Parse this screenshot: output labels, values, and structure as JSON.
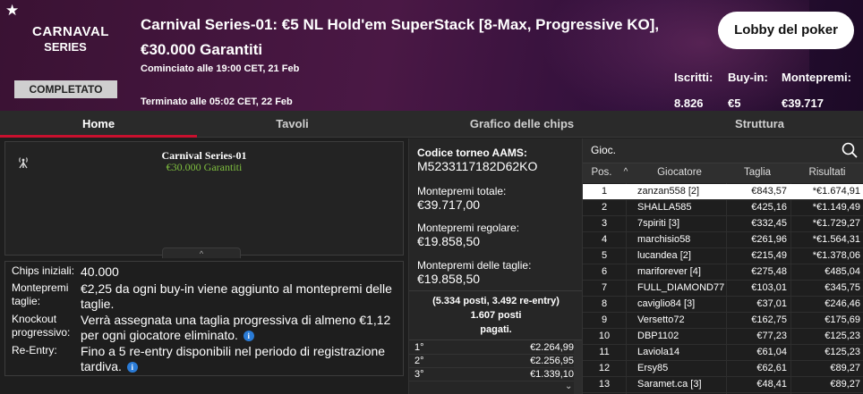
{
  "header": {
    "star": "★",
    "logo_line1": "CARNAVAL",
    "logo_line2": "SERIES",
    "status": "COMPLETATO",
    "title_line1": "Carnival Series-01: €5 NL Hold'em SuperStack [8-Max, Progressive KO],",
    "title_line2": "€30.000 Garantiti",
    "started": "Cominciato alle 19:00 CET, 21 Feb",
    "ended": "Terminato alle 05:02 CET, 22 Feb",
    "lobby_button": "Lobby del poker",
    "stats": {
      "entrants_label": "Iscritti:",
      "entrants_value": "8.826",
      "buyin_label": "Buy-in:",
      "buyin_value": "€5",
      "prizepool_label": "Montepremi:",
      "prizepool_value": "€39.717"
    }
  },
  "tabs": [
    {
      "label": "Home",
      "active": true
    },
    {
      "label": "Tavoli",
      "active": false
    },
    {
      "label": "Grafico delle chips",
      "active": false
    },
    {
      "label": "Struttura",
      "active": false
    }
  ],
  "banner": {
    "title": "Carnival Series-01",
    "subtitle": "€30.000 Garantiti",
    "collapse_glyph": "^"
  },
  "info": {
    "starting_chips_label": "Chips iniziali:",
    "starting_chips_value": "40.000",
    "bounty_pool_label": "Montepremi taglie:",
    "bounty_pool_value": "€2,25 da ogni buy-in viene aggiunto al montepremi delle taglie.",
    "knockout_label": "Knockout progressivo:",
    "knockout_value": "Verrà assegnata una taglia progressiva di almeno €1,12 per ogni giocatore eliminato.",
    "reentry_label": "Re-Entry:",
    "reentry_value": "Fino a 5 re-entry disponibili nel periodo di registrazione tardiva.",
    "info_glyph": "i"
  },
  "middle": {
    "code_label": "Codice torneo AAMS:",
    "code_value": "M5233117182D62KO",
    "total_label": "Montepremi totale:",
    "total_value": "€39.717,00",
    "regular_label": "Montepremi regolare:",
    "regular_value": "€19.858,50",
    "bounty_label": "Montepremi delle taglie:",
    "bounty_value": "€19.858,50",
    "paid_line1": "(5.334 posti, 3.492 re-entry)",
    "paid_line2": "1.607 posti",
    "paid_line3": "pagati.",
    "payouts": [
      {
        "pos": "1°",
        "amount": "€2.264,99"
      },
      {
        "pos": "2°",
        "amount": "€2.256,95"
      },
      {
        "pos": "3°",
        "amount": "€1.339,10"
      }
    ],
    "scroll_glyph": "⌄"
  },
  "players": {
    "search_label": "Gioc.",
    "headers": {
      "pos": "Pos.",
      "sort": "^",
      "player": "Giocatore",
      "bounty": "Taglia",
      "result": "Risultati"
    },
    "rows": [
      {
        "pos": "1",
        "player": "zanzan558 [2]",
        "bounty": "€843,57",
        "result": "*€1.674,91"
      },
      {
        "pos": "2",
        "player": "SHALLA585",
        "bounty": "€425,16",
        "result": "*€1.149,49"
      },
      {
        "pos": "3",
        "player": "7spiriti [3]",
        "bounty": "€332,45",
        "result": "*€1.729,27"
      },
      {
        "pos": "4",
        "player": "marchisio58",
        "bounty": "€261,96",
        "result": "*€1.564,31"
      },
      {
        "pos": "5",
        "player": "lucandea [2]",
        "bounty": "€215,49",
        "result": "*€1.378,06"
      },
      {
        "pos": "6",
        "player": "mariforever [4]",
        "bounty": "€275,48",
        "result": "€485,04"
      },
      {
        "pos": "7",
        "player": "FULL_DIAMOND77",
        "bounty": "€103,01",
        "result": "€345,75"
      },
      {
        "pos": "8",
        "player": "caviglio84 [3]",
        "bounty": "€37,01",
        "result": "€246,46"
      },
      {
        "pos": "9",
        "player": "Versetto72",
        "bounty": "€162,75",
        "result": "€175,69"
      },
      {
        "pos": "10",
        "player": "DBP1102",
        "bounty": "€77,23",
        "result": "€125,23"
      },
      {
        "pos": "11",
        "player": "Laviola14",
        "bounty": "€61,04",
        "result": "€125,23"
      },
      {
        "pos": "12",
        "player": "Ersy85",
        "bounty": "€62,61",
        "result": "€89,27"
      },
      {
        "pos": "13",
        "player": "Saramet.ca [3]",
        "bounty": "€48,41",
        "result": "€89,27"
      }
    ]
  },
  "colors": {
    "accent": "#c8102e",
    "bounty_green": "#7fbf3f",
    "info_blue": "#2a7bd6"
  }
}
